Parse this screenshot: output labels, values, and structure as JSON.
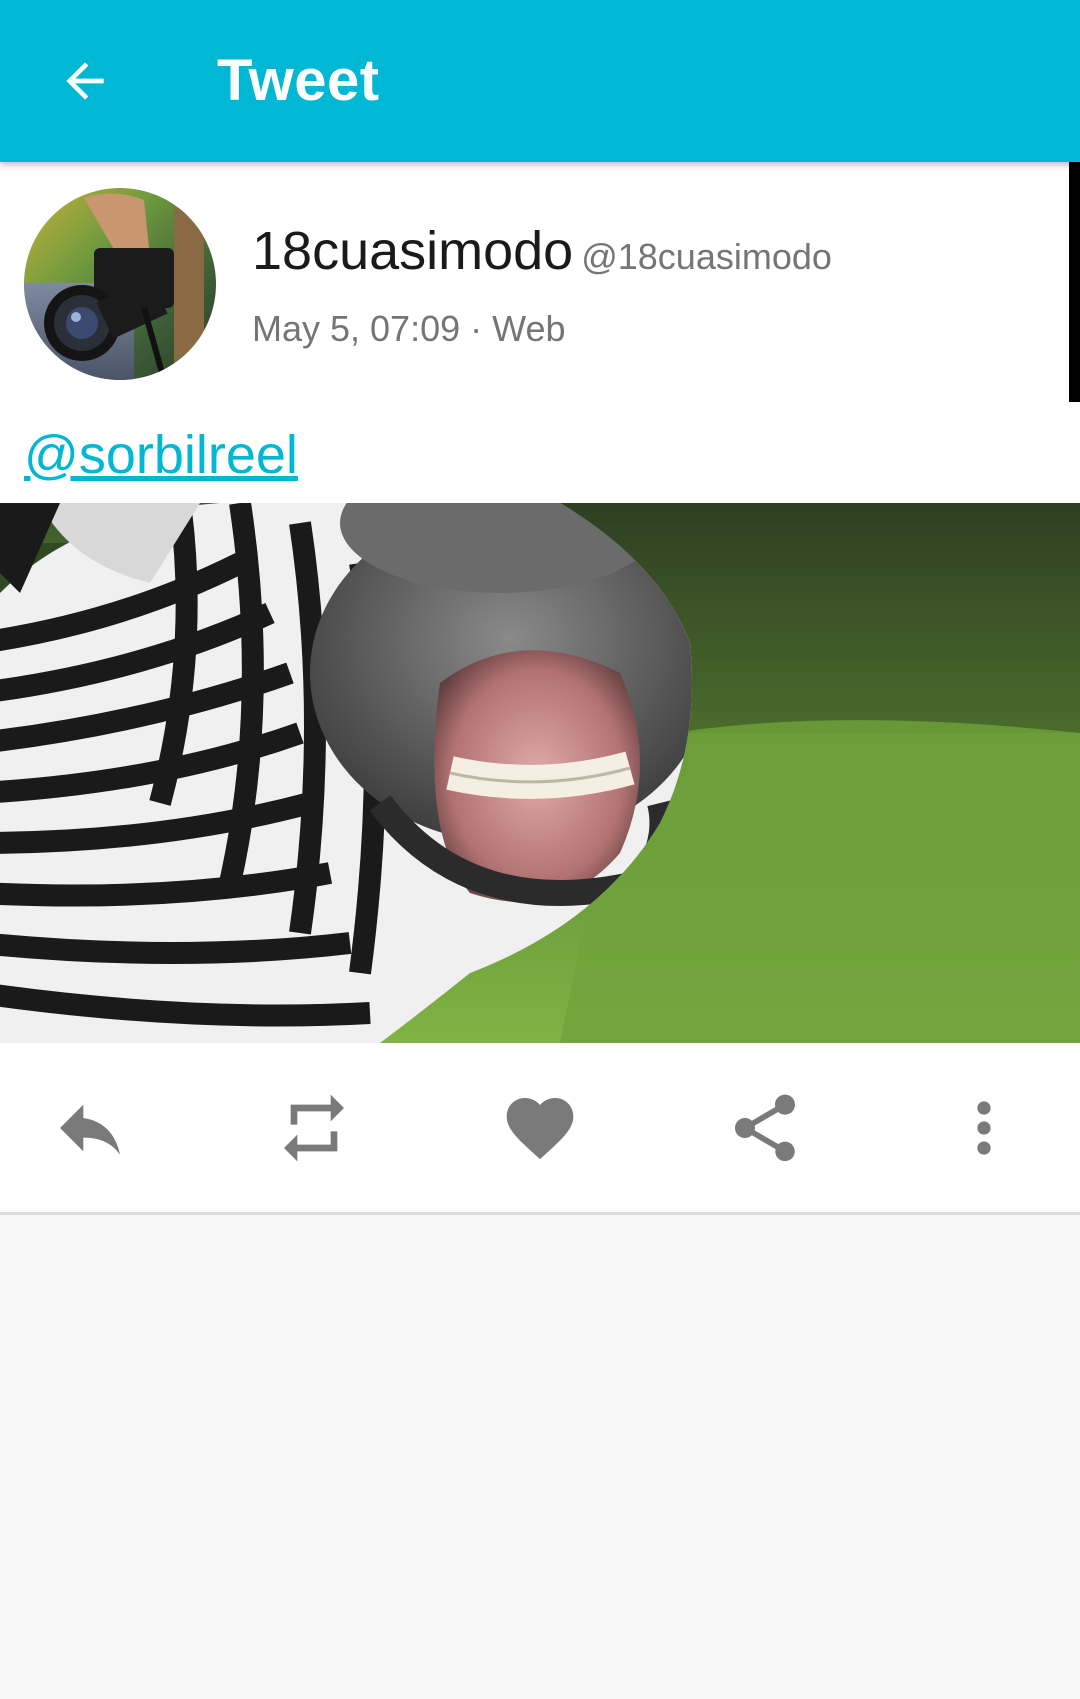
{
  "toolbar": {
    "title": "Tweet",
    "back_icon": "arrow-back-icon",
    "background_color": "#00b7d4"
  },
  "tweet": {
    "author": {
      "display_name": "18cuasimodo",
      "screen_name": "@18cuasimodo",
      "avatar_icon": "avatar-photo-camera"
    },
    "timestamp": "May 5, 07:09",
    "separator": " · ",
    "source": "Web",
    "mention": "@sorbilreel",
    "media_icon": "zebra-photo"
  },
  "actions": [
    {
      "name": "reply",
      "icon": "reply-icon"
    },
    {
      "name": "retweet",
      "icon": "retweet-icon"
    },
    {
      "name": "like",
      "icon": "heart-icon"
    },
    {
      "name": "share",
      "icon": "share-icon"
    },
    {
      "name": "more",
      "icon": "more-vert-icon"
    }
  ],
  "colors": {
    "accent": "#00b7d4",
    "icon_gray": "#7a7a7a",
    "text_primary": "#1a1a1a",
    "text_secondary": "#757575"
  }
}
